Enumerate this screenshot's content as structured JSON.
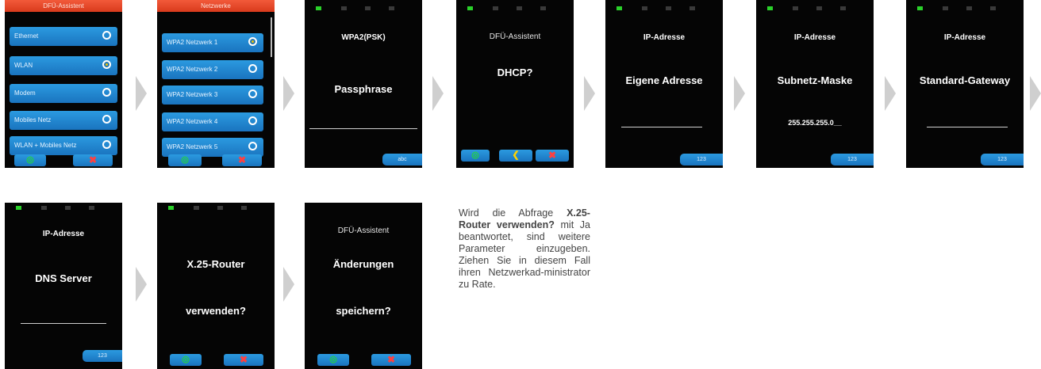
{
  "screens": {
    "dfu": {
      "title": "DFÜ-Assistent",
      "items": [
        "Ethernet",
        "WLAN",
        "Modem",
        "Mobiles Netz",
        "WLAN + Mobiles Netz"
      ],
      "selected": "WLAN"
    },
    "netzwerke": {
      "title": "Netzwerke",
      "items": [
        "WPA2 Netzwerk 1",
        "WPA2 Netzwerk 2",
        "WPA2 Netzwerk 3",
        "WPA2 Netzwerk 4",
        "WPA2 Netzwerk 5"
      ],
      "selected": "WPA2 Netzwerk 1"
    },
    "passphrase": {
      "header": "WPA2(PSK)",
      "main": "Passphrase",
      "key_button": "abc"
    },
    "dhcp": {
      "header": "DFÜ-Assistent",
      "main": "DHCP?"
    },
    "eigene": {
      "header": "IP-Adresse",
      "main": "Eigene Adresse",
      "key_button": "123"
    },
    "subnetz": {
      "header": "IP-Adresse",
      "main": "Subnetz-Maske",
      "value": "255.255.255.0__",
      "key_button": "123"
    },
    "gateway": {
      "header": "IP-Adresse",
      "main": "Standard-Gateway",
      "key_button": "123"
    },
    "dns": {
      "header": "IP-Adresse",
      "main": "DNS Server",
      "key_button": "123"
    },
    "x25": {
      "line1": "X.25-Router",
      "line2": "verwenden?"
    },
    "speichern": {
      "header": "DFÜ-Assistent",
      "line1": "Änderungen",
      "line2": "speichern?"
    }
  },
  "icons": {
    "ok": "◎",
    "cancel": "✖",
    "back": "❮"
  },
  "notes": {
    "before": "Wird die Abfrage",
    "bold": "X.25-Router verwenden?",
    "after": "mit Ja beantwortet, sind weitere Parameter einzugeben. Ziehen Sie in diesem Fall ihren Netzwerkad-ministrator zu Rate."
  },
  "colors": {
    "led_active": "#2ad12a",
    "accent_blue": "#1a74bf",
    "title_red": "#e0461f"
  }
}
